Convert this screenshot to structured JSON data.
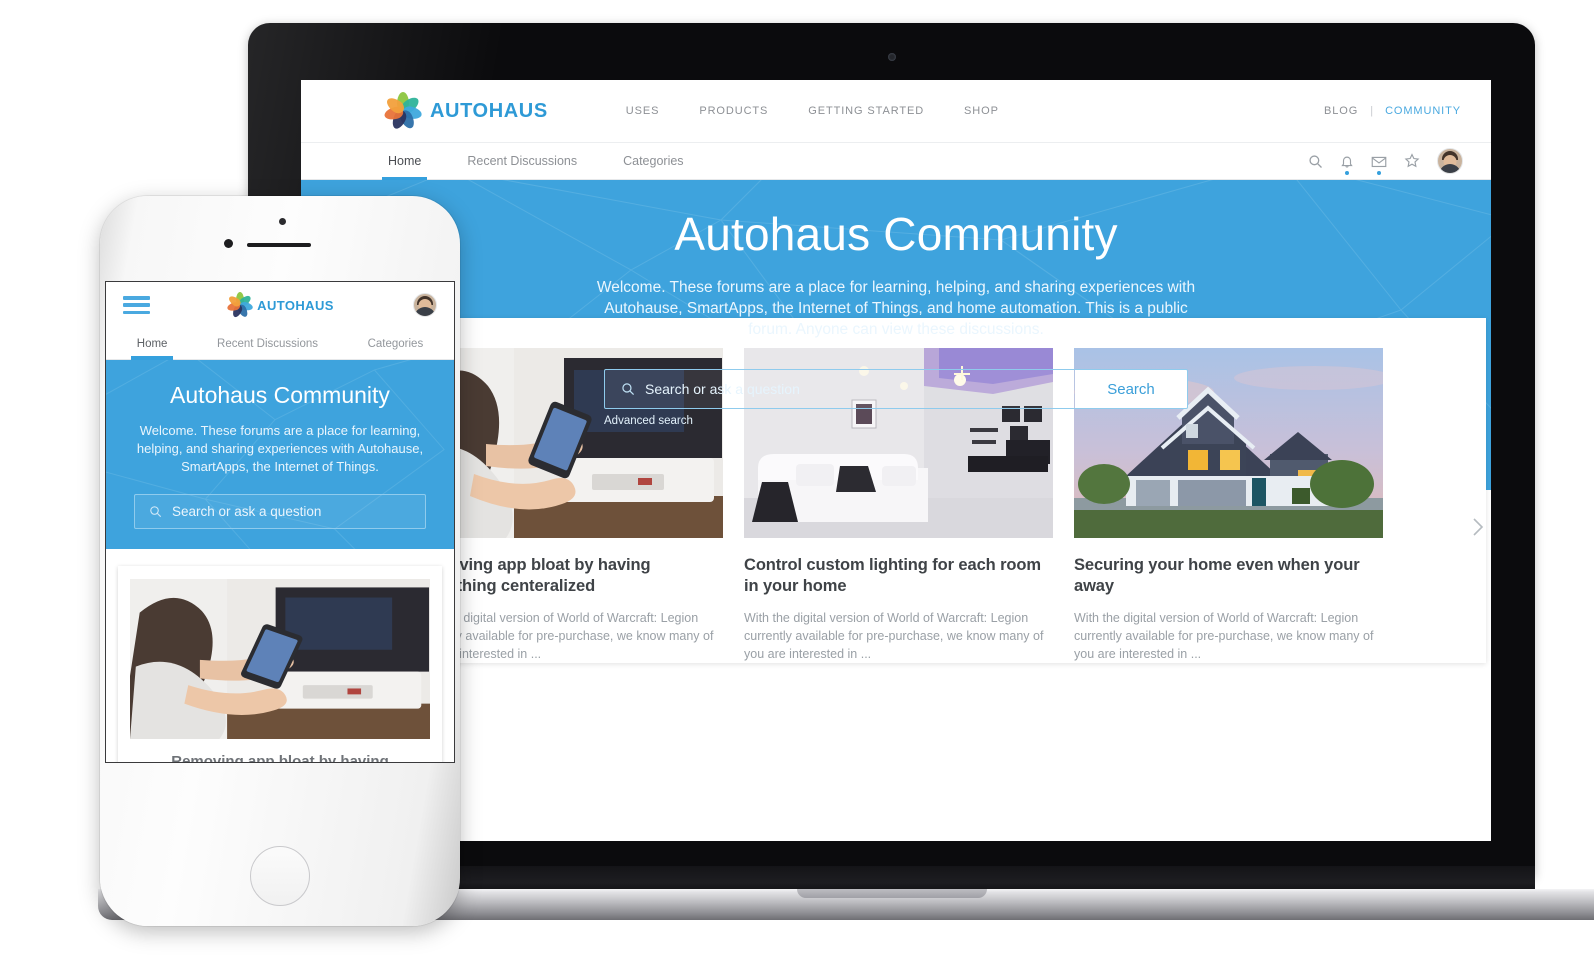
{
  "brand": {
    "name": "AUTOHAUS",
    "accent_blue": "#3ea3dd",
    "logo_colors": [
      "#7bc043",
      "#2fb39a",
      "#3fa9dd",
      "#2a3d6e",
      "#f08a3c"
    ]
  },
  "desktop": {
    "top_nav": {
      "items": [
        {
          "label": "USES"
        },
        {
          "label": "PRODUCTS"
        },
        {
          "label": "GETTING STARTED"
        },
        {
          "label": "SHOP"
        }
      ],
      "right": {
        "blog": "BLOG",
        "separator": "|",
        "community": "COMMUNITY"
      }
    },
    "sub_nav": {
      "tabs": [
        {
          "label": "Home",
          "active": true
        },
        {
          "label": "Recent Discussions",
          "active": false
        },
        {
          "label": "Categories",
          "active": false
        }
      ],
      "icons": [
        {
          "name": "search-icon"
        },
        {
          "name": "bell-icon"
        },
        {
          "name": "envelope-icon"
        },
        {
          "name": "star-icon"
        },
        {
          "name": "avatar"
        }
      ]
    },
    "hero": {
      "title": "Autohaus Community",
      "description": "Welcome. These forums are a place for learning, helping, and sharing experiences with Autohause, SmartApps, the Internet of Things, and home automation. This is a public forum. Anyone can view these discussions.",
      "search_placeholder": "Search or ask a question",
      "search_button": "Search",
      "advanced_search": "Advanced search"
    },
    "cards": [
      {
        "title": "Removing app bloat by having everything centeralized",
        "excerpt": "With the digital version of World of Warcraft: Legion currently available for pre-purchase, we know many of you are interested in ...",
        "image": "woman-holding-phone-in-living-room"
      },
      {
        "title": "Control custom lighting for each room in your home",
        "excerpt": "With the digital version of World of Warcraft: Legion currently available for pre-purchase, we know many of you are interested in ...",
        "image": "modern-living-room-with-purple-ceiling-lighting"
      },
      {
        "title": "Securing your home even when your away",
        "excerpt": "With the digital version of World of Warcraft: Legion currently available for pre-purchase, we know many of you are interested in ...",
        "image": "suburban-house-at-dusk-with-lit-windows"
      }
    ],
    "carousel_next": "›"
  },
  "mobile": {
    "menu_icon": "hamburger-icon",
    "brand": "AUTOHAUS",
    "tabs": [
      {
        "label": "Home",
        "active": true
      },
      {
        "label": "Recent Discussions",
        "active": false
      },
      {
        "label": "Categories",
        "active": false
      }
    ],
    "hero": {
      "title": "Autohaus Community",
      "description": "Welcome. These forums are a place for learning, helping, and sharing experiences with Autohause, SmartApps, the Internet of Things.",
      "search_placeholder": "Search or ask a question"
    },
    "card": {
      "title": "Removing app bloat by having",
      "image": "woman-holding-phone-in-living-room"
    }
  }
}
